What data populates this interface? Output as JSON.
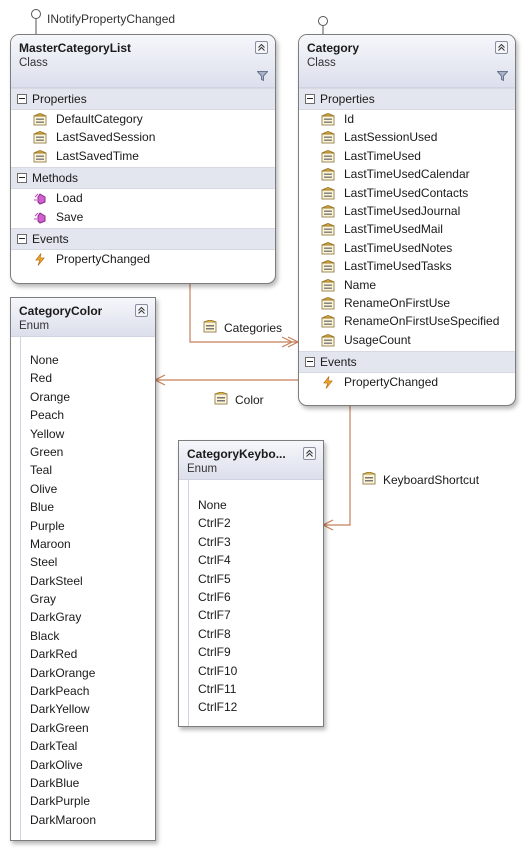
{
  "colors": {
    "line": "#c8805a",
    "header_bottom": "#dcdfec",
    "property_icon": "#e0b44a",
    "method_icon": "#c040c0",
    "event_icon": "#e8a020"
  },
  "interfaces": {
    "master_lollipop": "INotifyPropertyChanged"
  },
  "master_category_list": {
    "title": "MasterCategoryList",
    "kind": "Class",
    "sections": {
      "properties": "Properties",
      "methods": "Methods",
      "events": "Events"
    },
    "properties": [
      "DefaultCategory",
      "LastSavedSession",
      "LastSavedTime"
    ],
    "methods": [
      "Load",
      "Save"
    ],
    "events": [
      "PropertyChanged"
    ]
  },
  "category": {
    "title": "Category",
    "kind": "Class",
    "sections": {
      "properties": "Properties",
      "events": "Events"
    },
    "properties": [
      "Id",
      "LastSessionUsed",
      "LastTimeUsed",
      "LastTimeUsedCalendar",
      "LastTimeUsedContacts",
      "LastTimeUsedJournal",
      "LastTimeUsedMail",
      "LastTimeUsedNotes",
      "LastTimeUsedTasks",
      "Name",
      "RenameOnFirstUse",
      "RenameOnFirstUseSpecified",
      "UsageCount"
    ],
    "events": [
      "PropertyChanged"
    ]
  },
  "category_color": {
    "title": "CategoryColor",
    "kind": "Enum",
    "values": [
      "None",
      "Red",
      "Orange",
      "Peach",
      "Yellow",
      "Green",
      "Teal",
      "Olive",
      "Blue",
      "Purple",
      "Maroon",
      "Steel",
      "DarkSteel",
      "Gray",
      "DarkGray",
      "Black",
      "DarkRed",
      "DarkOrange",
      "DarkPeach",
      "DarkYellow",
      "DarkGreen",
      "DarkTeal",
      "DarkOlive",
      "DarkBlue",
      "DarkPurple",
      "DarkMaroon"
    ]
  },
  "category_keyboard": {
    "title": "CategoryKeybo...",
    "kind": "Enum",
    "values": [
      "None",
      "CtrlF2",
      "CtrlF3",
      "CtrlF4",
      "CtrlF5",
      "CtrlF6",
      "CtrlF7",
      "CtrlF8",
      "CtrlF9",
      "CtrlF10",
      "CtrlF11",
      "CtrlF12"
    ]
  },
  "associations": {
    "categories": "Categories",
    "color": "Color",
    "keyboard_shortcut": "KeyboardShortcut"
  }
}
